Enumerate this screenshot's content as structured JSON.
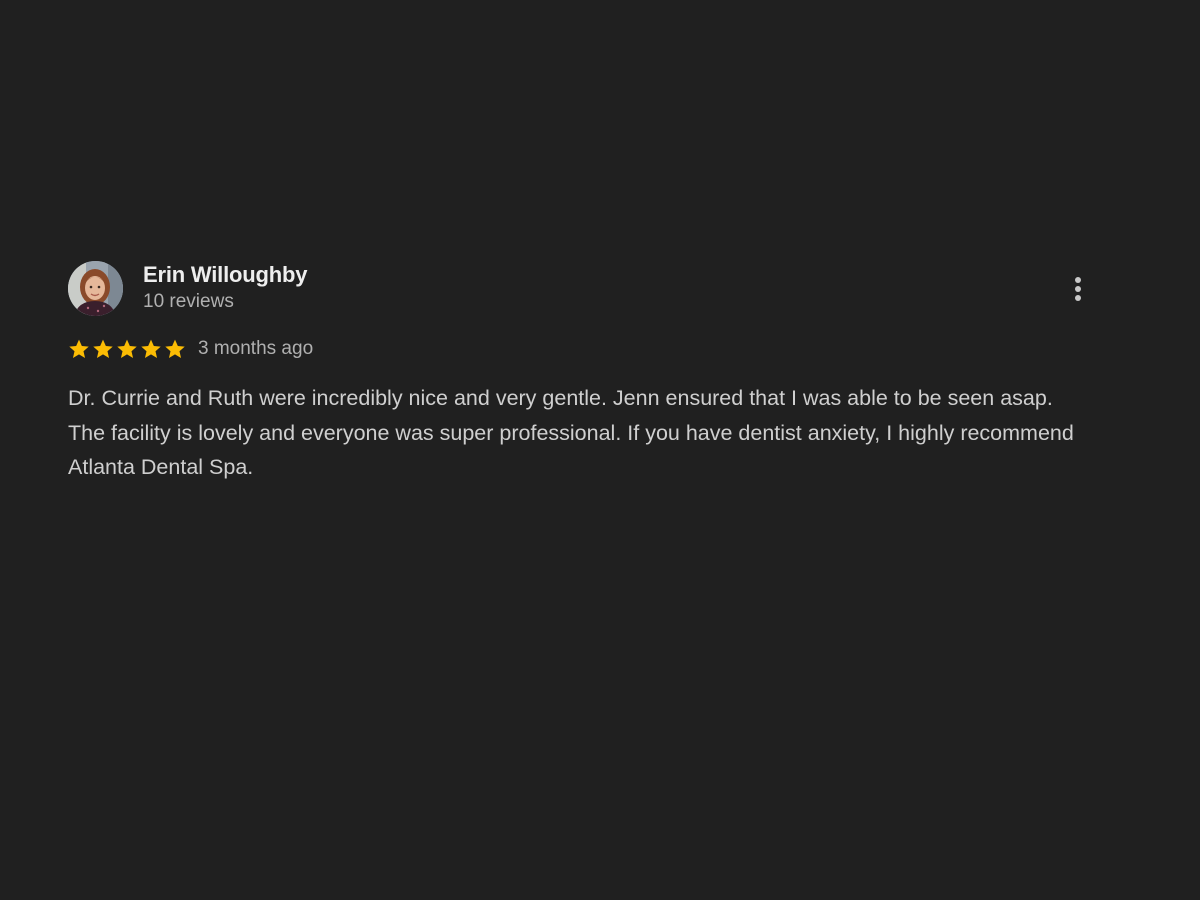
{
  "review": {
    "author": {
      "name": "Erin Willoughby",
      "review_count": "10 reviews",
      "avatar_icon": "reviewer-photo"
    },
    "rating": 5,
    "rating_max": 5,
    "star_color": "#FBBC04",
    "date": "3 months ago",
    "text": "Dr. Currie and Ruth were incredibly nice and very gentle. Jenn ensured that I was able to be seen asap. The facility is lovely and everyone was super professional. If you have dentist anxiety, I highly recommend Atlanta Dental Spa.",
    "menu_icon": "more-vert-icon"
  },
  "theme": {
    "background": "#202020",
    "primary_text": "#eeeeee",
    "secondary_text": "#b0b0b0",
    "body_text": "#cfcfcf"
  }
}
